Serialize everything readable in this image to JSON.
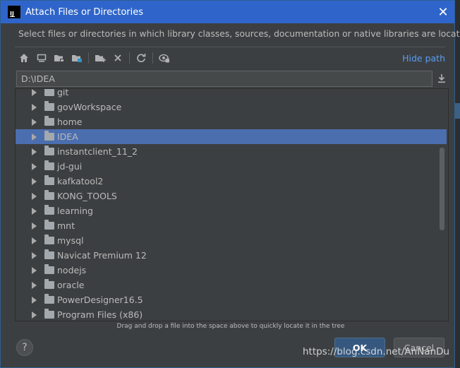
{
  "window": {
    "title": "Attach Files or Directories",
    "app_icon_text": "IJ",
    "close_glyph": "✕"
  },
  "description": "Select files or directories in which library classes, sources, documentation or native libraries are located",
  "toolbar": {
    "icons": [
      "home-icon",
      "desktop-icon",
      "project-folder-icon",
      "module-folder-icon",
      "new-folder-icon",
      "delete-icon",
      "refresh-icon",
      "show-hidden-icon"
    ],
    "hide_path_label": "Hide path"
  },
  "path": {
    "value": "D:\\IDEA"
  },
  "tree": {
    "items": [
      {
        "label": "git",
        "selected": false
      },
      {
        "label": "govWorkspace",
        "selected": false
      },
      {
        "label": "home",
        "selected": false
      },
      {
        "label": "IDEA",
        "selected": true
      },
      {
        "label": "instantclient_11_2",
        "selected": false
      },
      {
        "label": "jd-gui",
        "selected": false
      },
      {
        "label": "kafkatool2",
        "selected": false
      },
      {
        "label": "KONG_TOOLS",
        "selected": false
      },
      {
        "label": "learning",
        "selected": false
      },
      {
        "label": "mnt",
        "selected": false
      },
      {
        "label": "mysql",
        "selected": false
      },
      {
        "label": "Navicat Premium 12",
        "selected": false
      },
      {
        "label": "nodejs",
        "selected": false
      },
      {
        "label": "oracle",
        "selected": false
      },
      {
        "label": "PowerDesigner16.5",
        "selected": false
      },
      {
        "label": "Program Files (x86)",
        "selected": false
      }
    ]
  },
  "drag_hint": "Drag and drop a file into the space above to quickly locate it in the tree",
  "footer": {
    "help_label": "?",
    "ok_label": "OK",
    "cancel_label": "Cancel"
  },
  "watermark": "https://blog.csdn.net/AnNanDu",
  "colors": {
    "title_bar": "#2f65ca",
    "dialog_bg": "#3c3f41",
    "selection": "#4b6eaf",
    "link": "#589df6"
  }
}
